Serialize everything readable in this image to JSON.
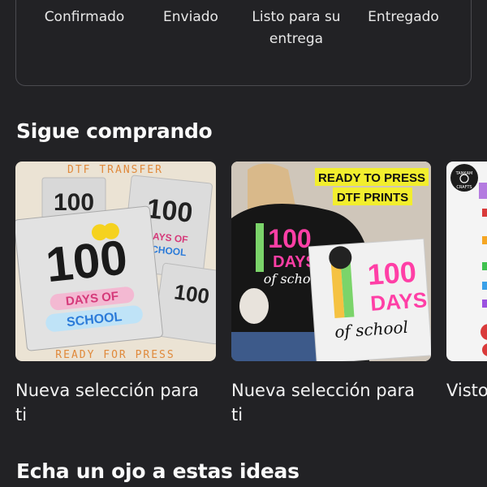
{
  "tracker": {
    "steps": [
      {
        "label": "Confirmado",
        "icon": "hand-icon",
        "status": "done"
      },
      {
        "label": "Enviado",
        "icon": "phone-icon",
        "status": "done"
      },
      {
        "label": "Listo para su entrega",
        "icon": "van-icon",
        "status": "pending"
      },
      {
        "label": "Entregado",
        "icon": "heart-icon",
        "status": "pending"
      }
    ],
    "colors": {
      "done": "#2e9a4b",
      "pending": "#4b4b50"
    }
  },
  "keep_shopping": {
    "title": "Sigue comprando",
    "cards": [
      {
        "caption": "Nueva selección para ti",
        "image": {
          "top_banner": "DTF TRANSFER",
          "bottom_banner": "READY FOR PRESS",
          "big_text": "100",
          "sub_text_1": "DAYS OF",
          "sub_text_2": "SCHOOL"
        }
      },
      {
        "caption": "Nueva selección para ti",
        "image": {
          "banner_1": "READY TO PRESS",
          "banner_2": "DTF PRINTS",
          "big_text": "100",
          "days_text": "DAYS",
          "script_text": "of school"
        }
      },
      {
        "caption": "Visto",
        "image": {
          "badge_line_1": "TANKAM",
          "badge_line_2": "CRAFTS"
        }
      }
    ]
  },
  "ideas": {
    "title": "Echa un ojo a estas ideas"
  }
}
